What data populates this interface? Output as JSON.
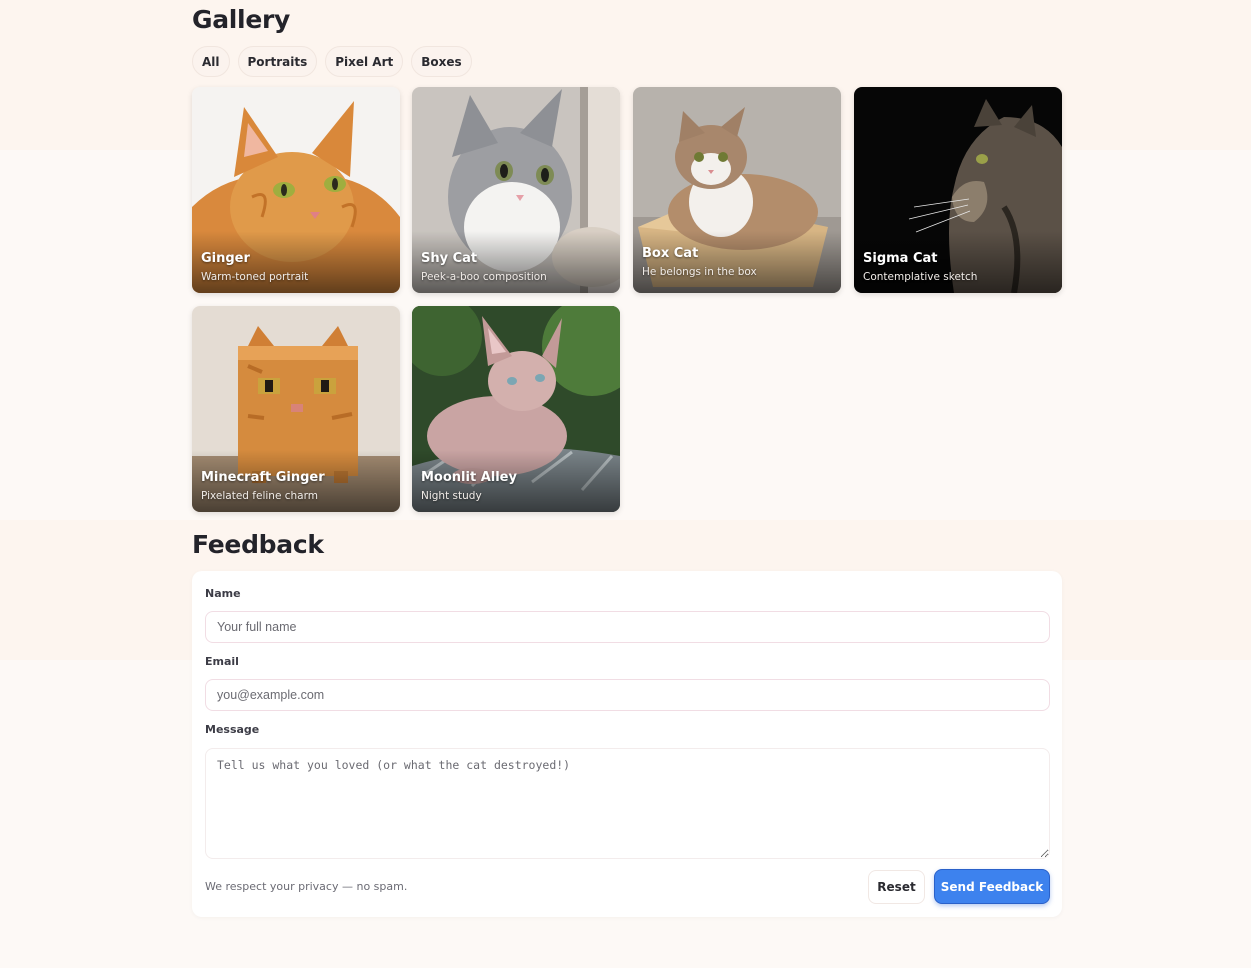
{
  "gallery": {
    "title": "Gallery",
    "filters": [
      "All",
      "Portraits",
      "Pixel Art",
      "Boxes"
    ],
    "cards": [
      {
        "title": "Ginger",
        "subtitle": "Warm-toned portrait"
      },
      {
        "title": "Shy Cat",
        "subtitle": "Peek-a-boo composition"
      },
      {
        "title": "Box Cat",
        "subtitle": "He belongs in the box"
      },
      {
        "title": "Sigma Cat",
        "subtitle": "Contemplative sketch"
      },
      {
        "title": "Minecraft Ginger",
        "subtitle": "Pixelated feline charm"
      },
      {
        "title": "Moonlit Alley",
        "subtitle": "Night study"
      }
    ]
  },
  "feedback": {
    "title": "Feedback",
    "name_label": "Name",
    "name_placeholder": "Your full name",
    "email_label": "Email",
    "email_placeholder": "you@example.com",
    "message_label": "Message",
    "message_placeholder": "Tell us what you loved (or what the cat destroyed!)",
    "privacy_note": "We respect your privacy — no spam.",
    "reset_label": "Reset",
    "send_label": "Send Feedback"
  },
  "colors": {
    "accent": "#3d82ee",
    "page_background": "#fdf9f6"
  }
}
